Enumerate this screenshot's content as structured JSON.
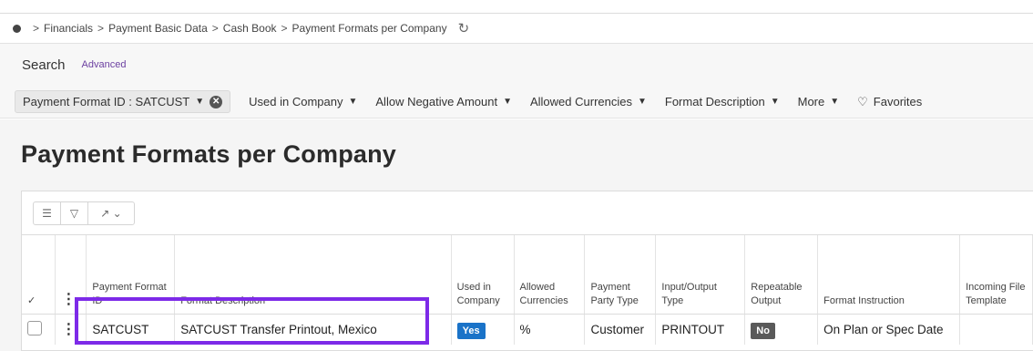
{
  "breadcrumb": {
    "items": [
      "Financials",
      "Payment Basic Data",
      "Cash Book",
      "Payment Formats per Company"
    ],
    "separator": ">"
  },
  "search": {
    "label": "Search",
    "advanced_label": "Advanced"
  },
  "filters": {
    "active_chip": "Payment Format ID : SATCUST",
    "items": [
      "Used in Company",
      "Allow Negative Amount",
      "Allowed Currencies",
      "Format Description",
      "More"
    ],
    "favorites_label": "Favorites"
  },
  "page": {
    "title": "Payment Formats per Company"
  },
  "grid": {
    "columns": [
      {
        "key": "payment_format_id",
        "label": "Payment Format ID"
      },
      {
        "key": "format_description",
        "label": "Format Description"
      },
      {
        "key": "used_in_company",
        "label": "Used in Company"
      },
      {
        "key": "allowed_currencies",
        "label": "Allowed Currencies"
      },
      {
        "key": "payment_party_type",
        "label": "Payment Party Type"
      },
      {
        "key": "input_output_type",
        "label": "Input/Output Type"
      },
      {
        "key": "repeatable_output",
        "label": "Repeatable Output"
      },
      {
        "key": "format_instruction",
        "label": "Format Instruction"
      },
      {
        "key": "incoming_file_template",
        "label": "Incoming File Template"
      }
    ],
    "rows": [
      {
        "payment_format_id": "SATCUST",
        "format_description": "SATCUST Transfer Printout, Mexico",
        "used_in_company": "Yes",
        "allowed_currencies": "%",
        "payment_party_type": "Customer",
        "input_output_type": "PRINTOUT",
        "repeatable_output": "No",
        "format_instruction": "On Plan or Spec Date",
        "incoming_file_template": ""
      }
    ]
  },
  "colors": {
    "highlight": "#7d2ae8",
    "yes_badge": "#1a73c8",
    "no_badge": "#5a5a5a",
    "advanced_link": "#6b3fa0"
  }
}
